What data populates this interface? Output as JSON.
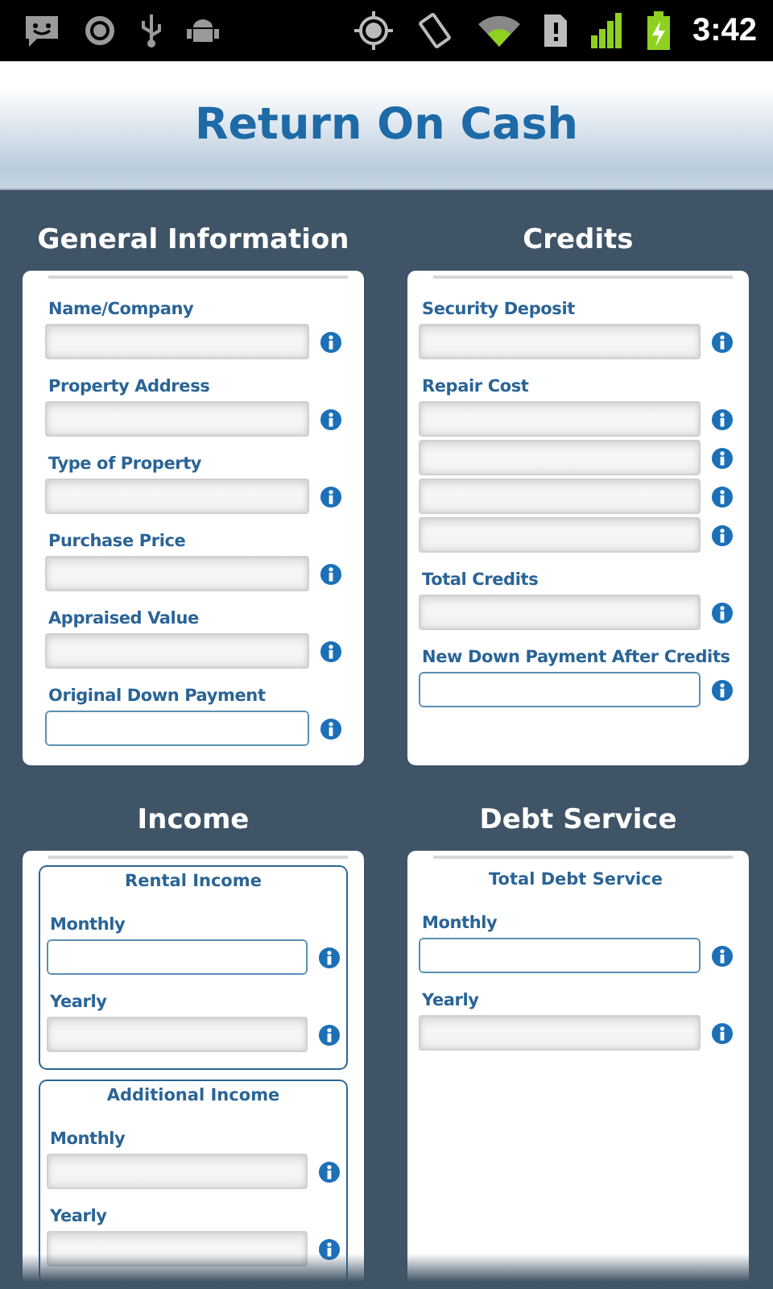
{
  "status_bar": {
    "time": "3:42"
  },
  "title": "Return On Cash",
  "sections": [
    {
      "heading": "General Information",
      "groups": [
        {
          "boxed": false,
          "fields": [
            {
              "label": "Name/Company",
              "editable": false
            },
            {
              "label": "Property Address",
              "editable": false
            },
            {
              "label": "Type of Property",
              "editable": false
            },
            {
              "label": "Purchase Price",
              "editable": false
            },
            {
              "label": "Appraised Value",
              "editable": false
            },
            {
              "label": "Original Down Payment",
              "editable": true
            }
          ]
        }
      ]
    },
    {
      "heading": "Credits",
      "groups": [
        {
          "boxed": false,
          "fields": [
            {
              "label": "Security Deposit",
              "editable": false
            },
            {
              "label": "Repair Cost",
              "editable": false
            },
            {
              "editable": false
            },
            {
              "editable": false
            },
            {
              "editable": false
            },
            {
              "label": "Total Credits",
              "editable": false
            },
            {
              "label": "New Down Payment After Credits",
              "editable": true
            }
          ]
        }
      ]
    },
    {
      "heading": "Income",
      "groups": [
        {
          "title": "Rental Income",
          "boxed": true,
          "fields": [
            {
              "label": "Monthly",
              "editable": true
            },
            {
              "label": "Yearly",
              "editable": false
            }
          ]
        },
        {
          "title": "Additional Income",
          "boxed": true,
          "fields": [
            {
              "label": "Monthly",
              "editable": false
            },
            {
              "label": "Yearly",
              "editable": false
            }
          ]
        }
      ]
    },
    {
      "heading": "Debt Service",
      "groups": [
        {
          "title": "Total Debt Service",
          "boxed": false,
          "fields": [
            {
              "label": "Monthly",
              "editable": true
            },
            {
              "label": "Yearly",
              "editable": false
            }
          ]
        }
      ]
    }
  ]
}
